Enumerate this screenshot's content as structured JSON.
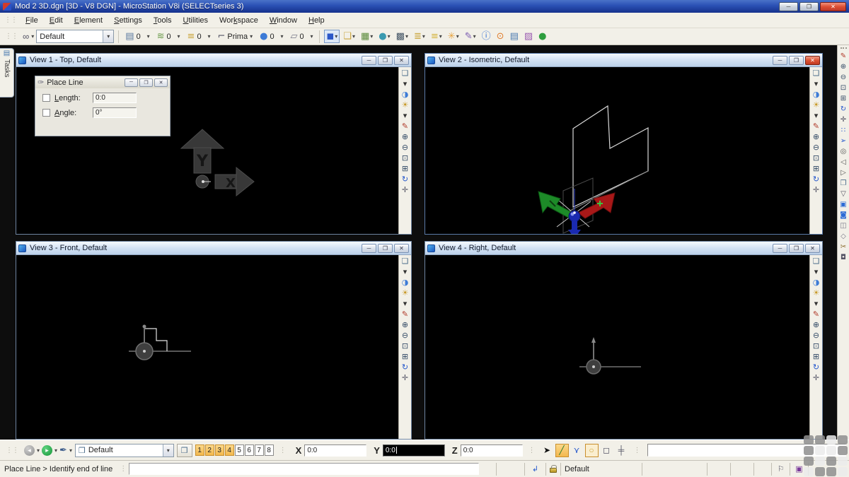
{
  "window": {
    "title": "Mod 2 3D.dgn [3D - V8 DGN] - MicroStation V8i (SELECTseries 3)"
  },
  "window_controls": {
    "minimize": "─",
    "restore": "❐",
    "close": "✕"
  },
  "menu": [
    {
      "label": "File",
      "u": 0
    },
    {
      "label": "Edit",
      "u": 0
    },
    {
      "label": "Element",
      "u": 0
    },
    {
      "label": "Settings",
      "u": 0
    },
    {
      "label": "Tools",
      "u": 0
    },
    {
      "label": "Utilities",
      "u": 0
    },
    {
      "label": "Workspace",
      "u": 3
    },
    {
      "label": "Window",
      "u": 0
    },
    {
      "label": "Help",
      "u": 0
    }
  ],
  "attributes_toolbar": {
    "tool_icon": {
      "name": "active-element-template-icon",
      "glyph": "∞",
      "color": "#555566"
    },
    "template_value": "Default",
    "fields": [
      {
        "name": "active-level-field",
        "glyph": "▤",
        "color": "#5b7aa0",
        "value": "0"
      },
      {
        "name": "active-color-field",
        "glyph": "≋",
        "color": "#6a9a4a",
        "value": "0"
      },
      {
        "name": "active-linestyle-field",
        "glyph": "≡",
        "color": "#caa53d",
        "value": "0"
      },
      {
        "name": "active-lineweight-field",
        "glyph": "⌐",
        "color": "#556",
        "value": "Prima"
      },
      {
        "name": "active-transparency-field",
        "glyph": "●",
        "color": "#3d7bd6",
        "value": "0"
      },
      {
        "name": "active-priority-field",
        "glyph": "▱",
        "color": "#778",
        "value": "0"
      }
    ]
  },
  "primary_toolbar": [
    {
      "name": "models-icon",
      "glyph": "◼",
      "color": "#2b57c8",
      "dropdown": true,
      "selected": true
    },
    {
      "name": "references-icon",
      "glyph": "❑",
      "color": "#caa53d",
      "dropdown": true
    },
    {
      "name": "raster-manager-icon",
      "glyph": "▦",
      "color": "#5a8a3a",
      "dropdown": true
    },
    {
      "name": "point-clouds-icon",
      "glyph": "●",
      "color": "#3a9ab0",
      "dropdown": true
    },
    {
      "name": "saved-views-icon",
      "glyph": "▩",
      "color": "#445566",
      "dropdown": true
    },
    {
      "name": "design-history-icon",
      "glyph": "≣",
      "color": "#caa53d",
      "dropdown": true
    },
    {
      "name": "level-manager-icon",
      "glyph": "≡",
      "color": "#d4b23a",
      "dropdown": true
    },
    {
      "name": "level-display-icon",
      "glyph": "✳",
      "color": "#e8a33d",
      "dropdown": true
    },
    {
      "name": "element-templates-icon",
      "glyph": "✎",
      "color": "#7a5ab0",
      "dropdown": true
    },
    {
      "name": "element-information-icon",
      "glyph": "ⓘ",
      "color": "#2b6bd6",
      "dropdown": false
    },
    {
      "name": "find-replace-icon",
      "glyph": "⊙",
      "color": "#e07b2a",
      "dropdown": false
    },
    {
      "name": "project-explorer-icon",
      "glyph": "▤",
      "color": "#4a7ab0",
      "dropdown": false
    },
    {
      "name": "markups-icon",
      "glyph": "▨",
      "color": "#9a5ab0",
      "dropdown": false
    },
    {
      "name": "accudraw-toggle-icon",
      "glyph": "●",
      "color": "#2e9e3e",
      "dropdown": false
    }
  ],
  "tasks_label": "Tasks",
  "views": [
    {
      "title": "View 1 - Top, Default",
      "active": false
    },
    {
      "title": "View 2 - Isometric, Default",
      "active": true
    },
    {
      "title": "View 3 - Front, Default",
      "active": false
    },
    {
      "title": "View 4 - Right, Default",
      "active": false
    }
  ],
  "view_toolbar": [
    {
      "name": "view-attributes-icon",
      "glyph": "❏",
      "color": "#4a6b8a"
    },
    {
      "name": "view-attributes-dropdown-icon",
      "glyph": "▾",
      "color": "#333"
    },
    {
      "name": "display-style-icon",
      "glyph": "◑",
      "color": "#3d7bd6"
    },
    {
      "name": "adjust-brightness-icon",
      "glyph": "☀",
      "color": "#c89a2a"
    },
    {
      "name": "brightness-dropdown-icon",
      "glyph": "▾",
      "color": "#333"
    },
    {
      "name": "update-view-icon",
      "glyph": "✎",
      "color": "#b03a2a"
    },
    {
      "name": "zoom-in-icon",
      "glyph": "⊕",
      "color": "#334a66"
    },
    {
      "name": "zoom-out-icon",
      "glyph": "⊖",
      "color": "#334a66"
    },
    {
      "name": "window-area-icon",
      "glyph": "⊡",
      "color": "#334a66"
    },
    {
      "name": "fit-view-icon",
      "glyph": "⊞",
      "color": "#334a66"
    },
    {
      "name": "rotate-view-icon",
      "glyph": "↻",
      "color": "#2255cc"
    },
    {
      "name": "pan-view-icon",
      "glyph": "✛",
      "color": "#556"
    }
  ],
  "right_toolbar": [
    {
      "name": "update-view-icon",
      "glyph": "✎",
      "color": "#b03a2a"
    },
    {
      "name": "zoom-in-icon",
      "glyph": "⊕",
      "color": "#334a66"
    },
    {
      "name": "zoom-out-icon",
      "glyph": "⊖",
      "color": "#334a66"
    },
    {
      "name": "window-area-icon",
      "glyph": "⊡",
      "color": "#334a66"
    },
    {
      "name": "fit-view-icon",
      "glyph": "⊞",
      "color": "#334a66"
    },
    {
      "name": "rotate-view-icon",
      "glyph": "↻",
      "color": "#2255cc"
    },
    {
      "name": "pan-view-icon",
      "glyph": "✛",
      "color": "#556"
    },
    {
      "name": "walk-icon",
      "glyph": "∷",
      "color": "#2255cc"
    },
    {
      "name": "fly-icon",
      "glyph": "➢",
      "color": "#2255cc"
    },
    {
      "name": "navigate-view-icon",
      "glyph": "◎",
      "color": "#555"
    },
    {
      "name": "view-previous-icon",
      "glyph": "◁",
      "color": "#555"
    },
    {
      "name": "view-next-icon",
      "glyph": "▷",
      "color": "#555"
    },
    {
      "name": "copy-view-icon",
      "glyph": "❐",
      "color": "#4a6b8a"
    },
    {
      "name": "clip-volume-icon",
      "glyph": "▽",
      "color": "#556"
    },
    {
      "name": "display-rules-icon",
      "glyph": "▣",
      "color": "#2b6bd6"
    },
    {
      "name": "saved-view-icon",
      "glyph": "◙",
      "color": "#2b6bd6"
    },
    {
      "name": "camera-settings-icon",
      "glyph": "◫",
      "color": "#778"
    },
    {
      "name": "render-icon",
      "glyph": "◇",
      "color": "#778"
    },
    {
      "name": "clip-tools-icon",
      "glyph": "✂",
      "color": "#8a6a2a"
    },
    {
      "name": "clip-mask-icon",
      "glyph": "◘",
      "color": "#556"
    }
  ],
  "place_line": {
    "title": "Place Line",
    "rows": [
      {
        "label": "Length:",
        "u": 0,
        "value": "0:0"
      },
      {
        "label": "Angle:",
        "u": 0,
        "value": "0°"
      }
    ]
  },
  "nav_toolbar": [
    {
      "name": "back-icon",
      "glyph": "◂",
      "style": "circle-gray"
    },
    {
      "name": "back-dropdown-icon",
      "glyph": "▾",
      "style": "caret"
    },
    {
      "name": "forward-icon",
      "glyph": "▸",
      "style": "circle-green"
    },
    {
      "name": "forward-dropdown-icon",
      "glyph": "▾",
      "style": "caret"
    },
    {
      "name": "view-history-icon",
      "glyph": "✒",
      "style": "plain",
      "color": "#3a5a8a"
    },
    {
      "name": "history-dropdown-icon",
      "glyph": "▾",
      "style": "caret"
    }
  ],
  "bottom_bar": {
    "view_group_value": "Default",
    "view_group_icon": {
      "name": "view-group-icon",
      "glyph": "❒",
      "color": "#4a6b8a"
    },
    "manage_view_groups_icon": {
      "name": "manage-view-groups-icon",
      "glyph": "❒",
      "color": "#4a6b8a"
    },
    "toggles": [
      {
        "label": "1",
        "active": true
      },
      {
        "label": "2",
        "active": true
      },
      {
        "label": "3",
        "active": true
      },
      {
        "label": "4",
        "active": true
      },
      {
        "label": "5",
        "active": false
      },
      {
        "label": "6",
        "active": false
      },
      {
        "label": "7",
        "active": false
      },
      {
        "label": "8",
        "active": false
      }
    ],
    "coord_labels": {
      "x": "X",
      "y": "Y",
      "z": "Z"
    },
    "coords": {
      "x": "0:0",
      "y": "0:0",
      "z": "0:0"
    },
    "keyin_value": ""
  },
  "snap_toolbar": [
    {
      "name": "element-selection-icon",
      "glyph": "➤",
      "color": "#111",
      "style": "plain"
    },
    {
      "name": "active-tool-line-icon",
      "glyph": "╱",
      "color": "#2a7a2a",
      "style": "active-bg"
    },
    {
      "name": "tentative-snap-icon",
      "glyph": "⋎",
      "color": "#2255cc",
      "style": "plain"
    },
    {
      "name": "accusnap-icon",
      "glyph": "○",
      "color": "#caa53d",
      "style": "active-border"
    },
    {
      "name": "fence-mode-icon",
      "glyph": "◻",
      "color": "#556",
      "style": "plain"
    },
    {
      "name": "grid-lock-icon",
      "glyph": "╪",
      "color": "#556",
      "style": "plain"
    }
  ],
  "status_bar": {
    "message": "Place Line > Identify end of line",
    "snap_icon": {
      "name": "snap-mode-icon",
      "glyph": "↲",
      "color": "#2255cc"
    },
    "mode": "Default",
    "fence_icon": {
      "name": "fence-status-icon",
      "glyph": "⚐",
      "color": "#556"
    },
    "history_icon": {
      "name": "design-history-status-icon",
      "glyph": "▣",
      "color": "#7a3a9a"
    }
  }
}
